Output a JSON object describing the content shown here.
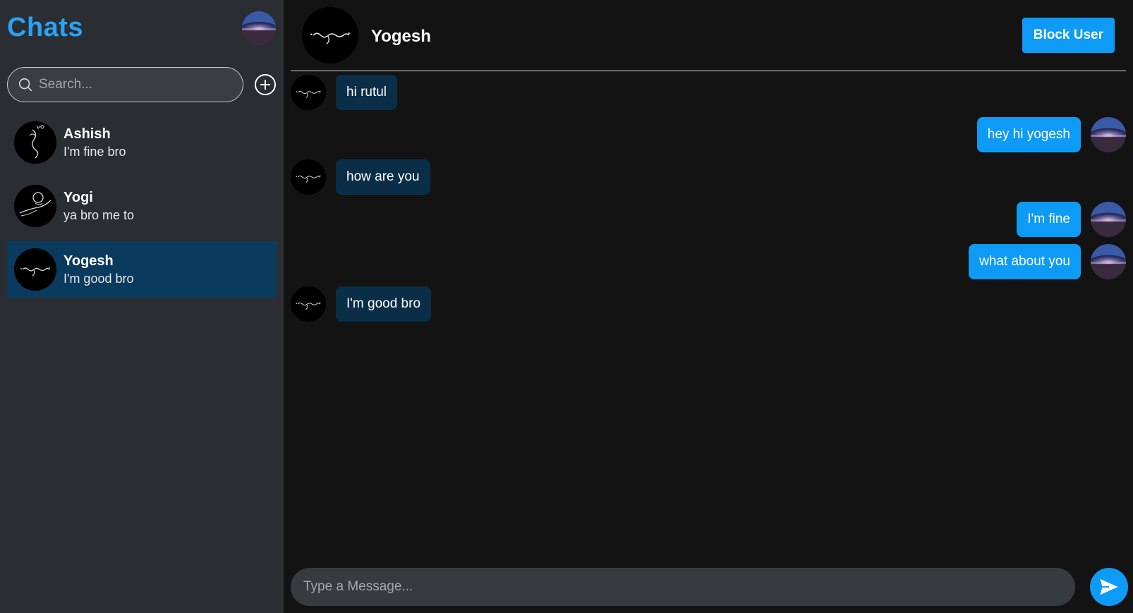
{
  "sidebar": {
    "title": "Chats",
    "search_placeholder": "Search...",
    "contacts": [
      {
        "name": "Ashish",
        "last_message": "I'm fine bro",
        "active": false
      },
      {
        "name": "Yogi",
        "last_message": "ya bro me to",
        "active": false
      },
      {
        "name": "Yogesh",
        "last_message": "I'm good bro",
        "active": true
      }
    ]
  },
  "chat": {
    "contact_name": "Yogesh",
    "block_label": "Block User",
    "messages": [
      {
        "text": "hi rutul",
        "direction": "received"
      },
      {
        "text": "hey hi yogesh",
        "direction": "sent"
      },
      {
        "text": "how are you",
        "direction": "received"
      },
      {
        "text": "I'm fine",
        "direction": "sent"
      },
      {
        "text": "what about you",
        "direction": "sent"
      },
      {
        "text": "I'm good bro",
        "direction": "received"
      }
    ],
    "composer_placeholder": "Type a Message..."
  },
  "icons": {
    "search": "search-icon",
    "add": "plus-circle-icon",
    "send": "send-icon"
  },
  "colors": {
    "accent": "#0e9bf5",
    "title": "#2aa2f5",
    "sidebar_bg": "#2a2d31",
    "chat_bg": "#131314",
    "active_contact_bg": "#0a3a5e",
    "received_bubble": "#0a2e47",
    "sent_bubble": "#0e9bf5"
  }
}
